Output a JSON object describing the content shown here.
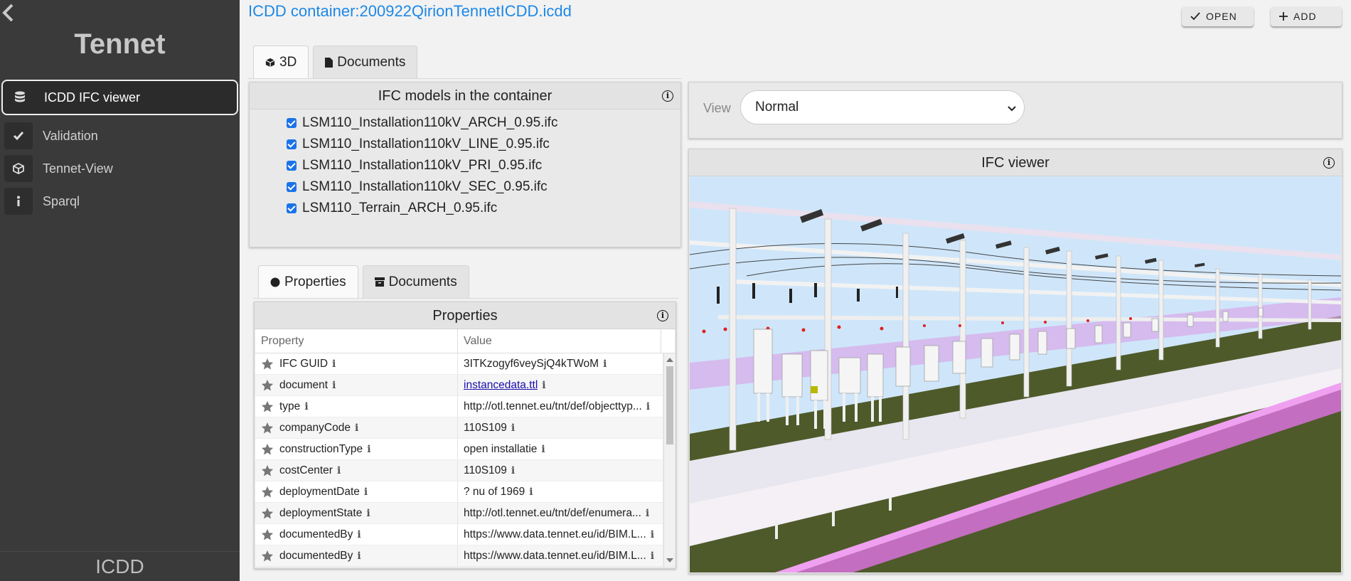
{
  "sidebar": {
    "brand": "Tennet",
    "items": [
      {
        "label": "ICDD IFC viewer",
        "icon": "database-icon"
      },
      {
        "label": "Validation",
        "icon": "check-icon"
      },
      {
        "label": "Tennet-View",
        "icon": "cube-icon"
      },
      {
        "label": "Sparql",
        "icon": "info-icon"
      }
    ],
    "footer": "ICDD"
  },
  "header": {
    "title": "ICDD container:200922QirionTennetICDD.icdd",
    "open_label": "OPEN",
    "add_label": "ADD"
  },
  "main_tabs": [
    {
      "label": "3D",
      "icon": "cube-icon",
      "active": true
    },
    {
      "label": "Documents",
      "icon": "file-icon",
      "active": false
    }
  ],
  "models_panel": {
    "title": "IFC models in the container",
    "models": [
      {
        "name": "LSM110_Installation110kV_ARCH_0.95.ifc",
        "checked": true
      },
      {
        "name": "LSM110_Installation110kV_LINE_0.95.ifc",
        "checked": true
      },
      {
        "name": "LSM110_Installation110kV_PRI_0.95.ifc",
        "checked": true
      },
      {
        "name": "LSM110_Installation110kV_SEC_0.95.ifc",
        "checked": true
      },
      {
        "name": "LSM110_Terrain_ARCH_0.95.ifc",
        "checked": true
      }
    ]
  },
  "view_panel": {
    "label": "View",
    "selected": "Normal"
  },
  "ifc_viewer": {
    "title": "IFC viewer"
  },
  "prop_tabs": [
    {
      "label": "Properties",
      "icon": "circle-icon",
      "active": true
    },
    {
      "label": "Documents",
      "icon": "archive-icon",
      "active": false
    }
  ],
  "properties": {
    "title": "Properties",
    "col_property": "Property",
    "col_value": "Value",
    "rows": [
      {
        "property": "IFC GUID",
        "value": "3ITKzogyf6veySjQ4kTWoM",
        "link": false
      },
      {
        "property": "document",
        "value": "instancedata.ttl",
        "link": true
      },
      {
        "property": "type",
        "value": "http://otl.tennet.eu/tnt/def/objecttyp...",
        "link": false
      },
      {
        "property": "companyCode",
        "value": "110S109",
        "link": false
      },
      {
        "property": "constructionType",
        "value": "open installatie",
        "link": false
      },
      {
        "property": "costCenter",
        "value": "110S109",
        "link": false
      },
      {
        "property": "deploymentDate",
        "value": "? nu of 1969",
        "link": false
      },
      {
        "property": "deploymentState",
        "value": "http://otl.tennet.eu/tnt/def/enumera...",
        "link": false
      },
      {
        "property": "documentedBy",
        "value": "https://www.data.tennet.eu/id/BIM.L...",
        "link": false
      },
      {
        "property": "documentedBy",
        "value": "https://www.data.tennet.eu/id/BIM.L...",
        "link": false
      }
    ]
  },
  "colors": {
    "sidebar_bg": "#3a3a3a",
    "accent": "#1e88e5",
    "sky": "#cfe6fa",
    "ground": "#4e5a2a",
    "fence": "#e060e0"
  }
}
